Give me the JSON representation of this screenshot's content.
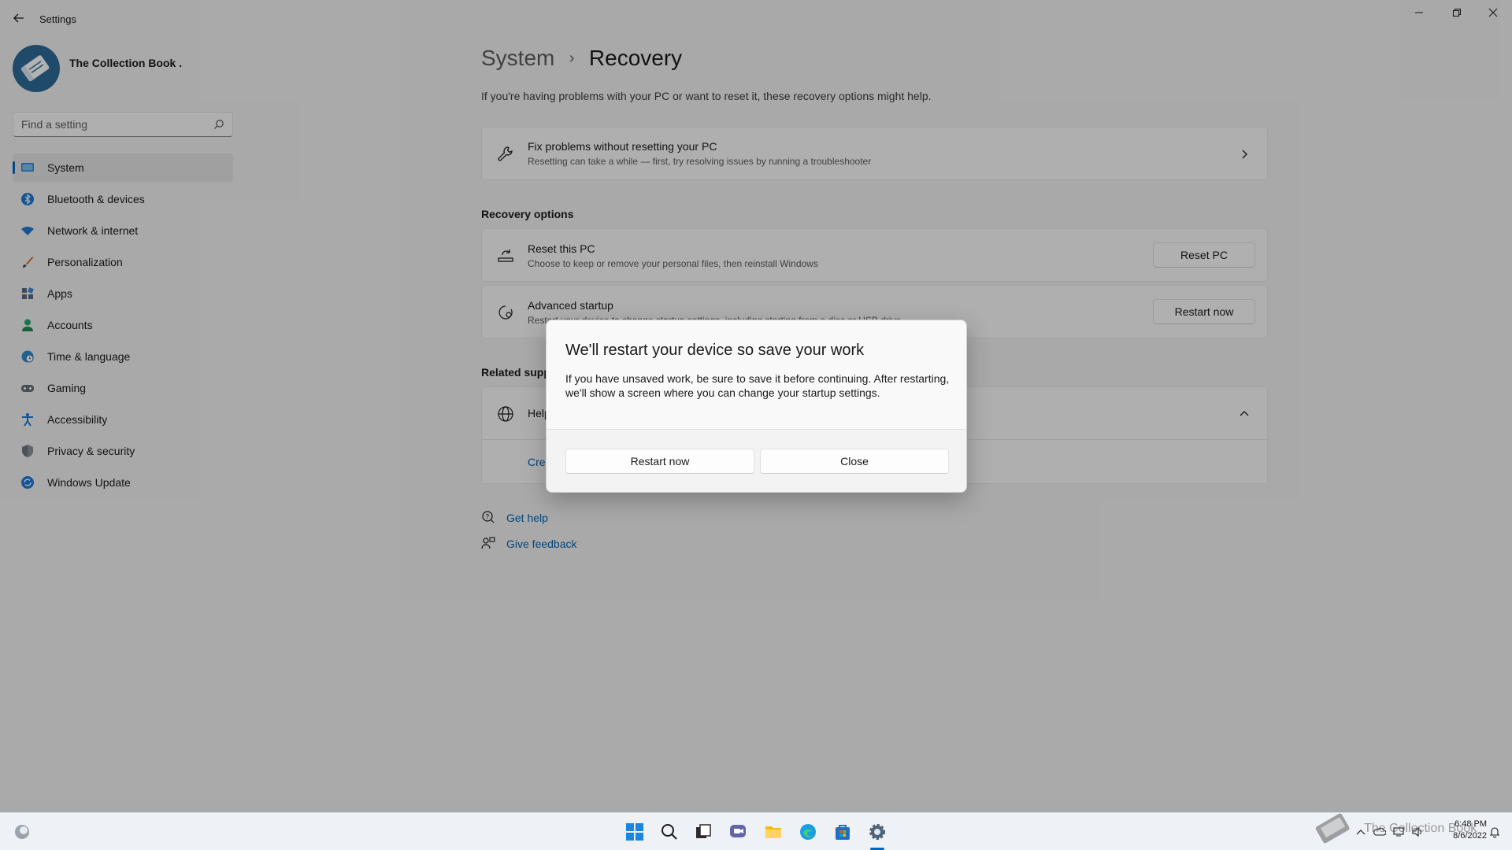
{
  "window": {
    "app_title": "Settings",
    "controls": [
      "minimize",
      "restore",
      "close"
    ]
  },
  "profile": {
    "name": "The Collection Book ."
  },
  "search": {
    "placeholder": "Find a setting"
  },
  "sidebar": {
    "items": [
      {
        "label": "System",
        "icon": "system-icon",
        "active": true
      },
      {
        "label": "Bluetooth & devices",
        "icon": "bluetooth-icon"
      },
      {
        "label": "Network & internet",
        "icon": "wifi-icon"
      },
      {
        "label": "Personalization",
        "icon": "brush-icon"
      },
      {
        "label": "Apps",
        "icon": "apps-icon"
      },
      {
        "label": "Accounts",
        "icon": "accounts-icon"
      },
      {
        "label": "Time & language",
        "icon": "globe-clock-icon"
      },
      {
        "label": "Gaming",
        "icon": "gamepad-icon"
      },
      {
        "label": "Accessibility",
        "icon": "accessibility-icon"
      },
      {
        "label": "Privacy & security",
        "icon": "shield-icon"
      },
      {
        "label": "Windows Update",
        "icon": "update-icon"
      }
    ]
  },
  "main": {
    "breadcrumb": {
      "parent": "System",
      "separator": "›",
      "current": "Recovery"
    },
    "subtitle": "If you're having problems with your PC or want to reset it, these recovery options might help.",
    "fix_card": {
      "title": "Fix problems without resetting your PC",
      "description": "Resetting can take a while — first, try resolving issues by running a troubleshooter"
    },
    "recovery_options_heading": "Recovery options",
    "reset_card": {
      "title": "Reset this PC",
      "description": "Choose to keep or remove your personal files, then reinstall Windows",
      "button": "Reset PC"
    },
    "advanced_card": {
      "title": "Advanced startup",
      "description": "Restart your device to change startup settings, including starting from a disc or USB drive",
      "button": "Restart now"
    },
    "related_heading": "Related supp",
    "help_card": {
      "title": "Help",
      "link": "Cre"
    },
    "links": {
      "get_help": "Get help",
      "give_feedback": "Give feedback"
    }
  },
  "dialog": {
    "title": "We'll restart your device so save your work",
    "body": "If you have unsaved work, be sure to save it before continuing. After restarting, we'll show a screen where you can change your startup settings.",
    "primary_button": "Restart now",
    "secondary_button": "Close"
  },
  "taskbar": {
    "apps": [
      "start-icon",
      "search-icon",
      "task-view-icon",
      "chat-icon",
      "file-explorer-icon",
      "edge-icon",
      "store-icon",
      "settings-icon"
    ],
    "clock": {
      "time": "6:48 PM",
      "date": "8/6/2022"
    },
    "watermark": "The Collection Book"
  },
  "colors": {
    "accent": "#0067c0",
    "link": "#0063b1",
    "background": "#f3f3f3"
  }
}
